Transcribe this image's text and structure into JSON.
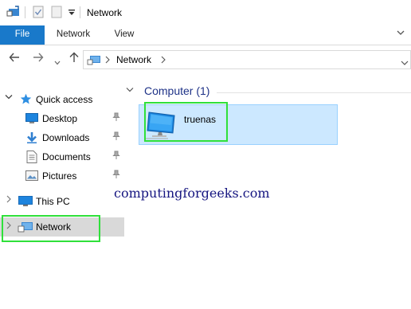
{
  "window": {
    "title": "Network"
  },
  "quick_access_toolbar": {
    "icons": [
      "properties-icon",
      "checkmark-icon",
      "new-folder-icon",
      "dropdown-icon"
    ]
  },
  "ribbon": {
    "tabs": [
      {
        "label": "File",
        "active": true
      },
      {
        "label": "Network"
      },
      {
        "label": "View"
      }
    ],
    "expand_icon": "chevron-down-icon"
  },
  "navigation": {
    "back_icon": "arrow-left-icon",
    "forward_icon": "arrow-right-icon",
    "recent_icon": "chevron-down-icon",
    "up_icon": "arrow-up-icon",
    "address": {
      "path": "Network"
    }
  },
  "nav_pane": {
    "quick_access": {
      "label": "Quick access",
      "items": [
        {
          "label": "Desktop",
          "pinned": true
        },
        {
          "label": "Downloads",
          "pinned": true
        },
        {
          "label": "Documents",
          "pinned": true
        },
        {
          "label": "Pictures",
          "pinned": true
        }
      ]
    },
    "this_pc": {
      "label": "This PC"
    },
    "network": {
      "label": "Network",
      "selected": true
    }
  },
  "content": {
    "group_header": "Computer (1)",
    "items": [
      {
        "label": "truenas",
        "selected": true
      }
    ]
  },
  "watermark": "computingforgeeks.com",
  "colors": {
    "accent": "#1979ca",
    "selection_bg": "#cce8ff",
    "selection_border": "#99d1ff",
    "highlight_box": "#2fe03a",
    "group_header": "#1e3287",
    "watermark": "#151580"
  }
}
